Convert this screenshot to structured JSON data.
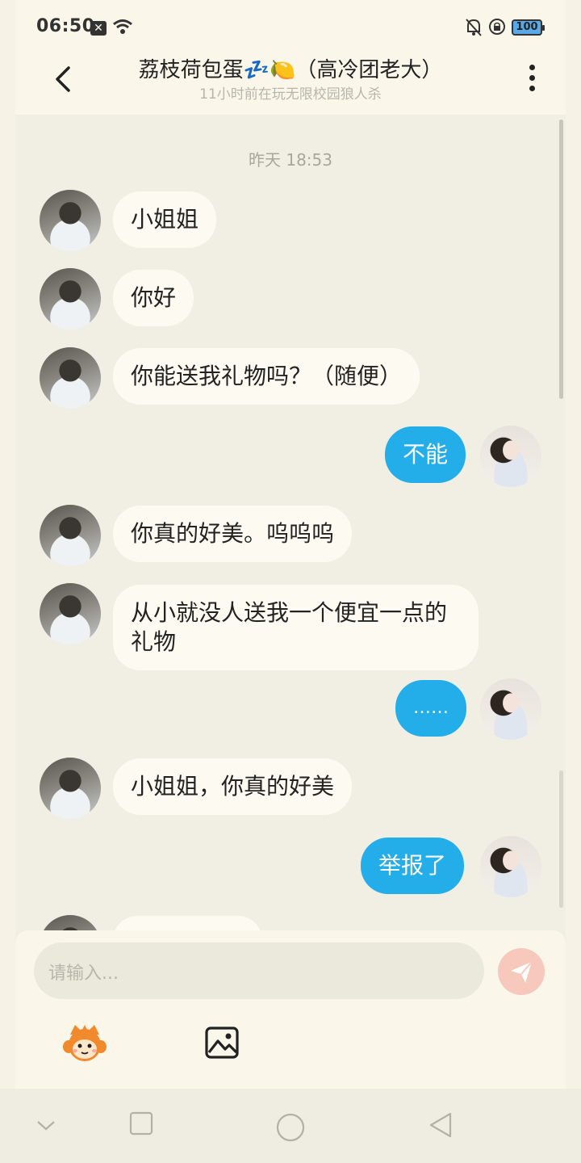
{
  "status_bar": {
    "time": "06:50",
    "battery": "100"
  },
  "header": {
    "title": "荔枝荷包蛋💤🍋（高冷团老大）",
    "subtitle": "11小时前在玩无限校园狼人杀"
  },
  "chat": {
    "timestamp": "昨天 18:53",
    "messages": [
      {
        "side": "left",
        "text": "小姐姐"
      },
      {
        "side": "left",
        "text": "你好"
      },
      {
        "side": "left",
        "text": "你能送我礼物吗？（随便）"
      },
      {
        "side": "right",
        "text": "不能"
      },
      {
        "side": "left",
        "text": "你真的好美。呜呜呜"
      },
      {
        "side": "left",
        "text": "从小就没人送我一个便宜一点的礼物"
      },
      {
        "side": "right",
        "text": "……"
      },
      {
        "side": "left",
        "text": "小姐姐，你真的好美"
      },
      {
        "side": "right",
        "text": "举报了"
      }
    ]
  },
  "composer": {
    "placeholder": "请输入..."
  },
  "icons": {
    "back": "back-arrow-icon",
    "more": "more-vertical-icon",
    "send": "send-icon",
    "mascot": "mascot-emoji-icon",
    "image": "image-icon"
  },
  "colors": {
    "outgoing_bubble": "#24aee9",
    "incoming_bubble": "#fcfaf1",
    "background": "#f1eee3"
  }
}
